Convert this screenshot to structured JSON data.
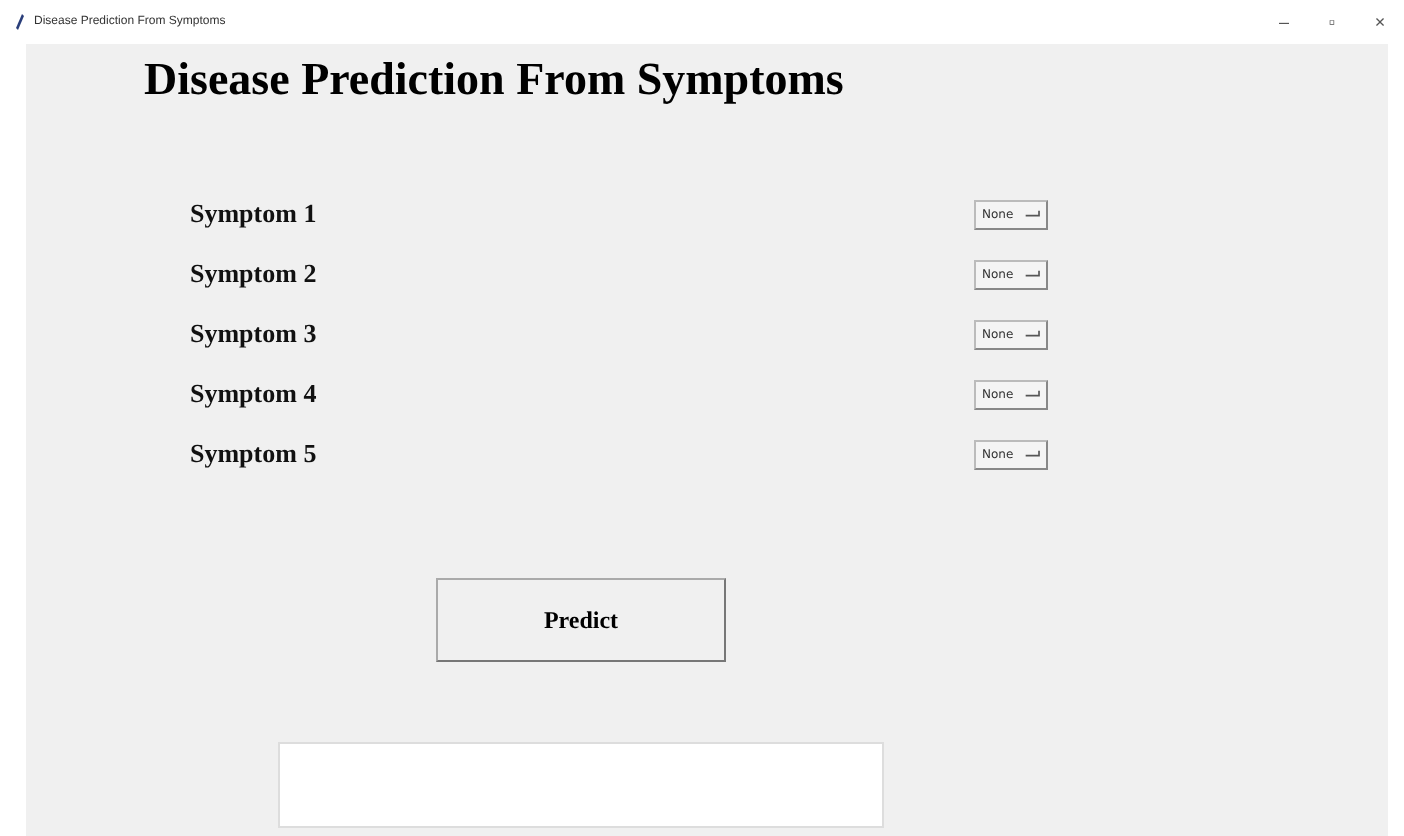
{
  "window": {
    "title": "Disease Prediction From Symptoms",
    "controls": [
      "–",
      "▫",
      "×"
    ]
  },
  "heading": "Disease Prediction From Symptoms",
  "symptoms": [
    {
      "label": "Symptom 1",
      "value": "None"
    },
    {
      "label": "Symptom 2",
      "value": "None"
    },
    {
      "label": "Symptom 3",
      "value": "None"
    },
    {
      "label": "Symptom 4",
      "value": "None"
    },
    {
      "label": "Symptom 5",
      "value": "None"
    }
  ],
  "predict_button": "Predict"
}
